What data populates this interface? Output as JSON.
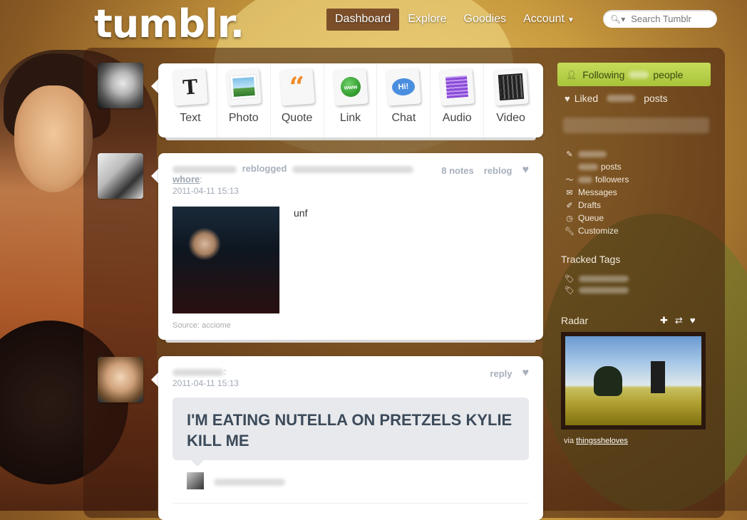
{
  "header": {
    "logo": "tumblr.",
    "nav": [
      {
        "label": "Dashboard",
        "active": true
      },
      {
        "label": "Explore",
        "active": false
      },
      {
        "label": "Goodies",
        "active": false
      },
      {
        "label": "Account",
        "active": false
      }
    ],
    "search_placeholder": "Search Tumblr"
  },
  "composer": {
    "types": [
      {
        "label": "Text",
        "icon": "text-icon"
      },
      {
        "label": "Photo",
        "icon": "photo-icon"
      },
      {
        "label": "Quote",
        "icon": "quote-icon"
      },
      {
        "label": "Link",
        "icon": "link-icon"
      },
      {
        "label": "Chat",
        "icon": "chat-icon"
      },
      {
        "label": "Audio",
        "icon": "audio-icon"
      },
      {
        "label": "Video",
        "icon": "video-icon"
      }
    ],
    "link_icon_text": "www",
    "chat_icon_text": "Hi!"
  },
  "posts": [
    {
      "reblogged_word": "reblogged",
      "who_label": "whore",
      "date": "2011-04-11 15:13",
      "notes": "8 notes",
      "reblog": "reblog",
      "text": "unf",
      "source": "Source: acciome"
    },
    {
      "colon": ":",
      "date": "2011-04-11 15:13",
      "reply": "reply",
      "chat_text": "I'M EATING NUTELLA ON PRETZELS KYLIE KILL ME"
    }
  ],
  "sidebar": {
    "following_pre": "Following",
    "following_post": "people",
    "liked_pre": "Liked",
    "liked_post": "posts",
    "links": [
      {
        "label": "",
        "icon": "edit-icon"
      },
      {
        "label": "posts",
        "icon": "posts-icon"
      },
      {
        "label": "followers",
        "icon": "followers-icon"
      },
      {
        "label": "Messages",
        "icon": "mail-icon"
      },
      {
        "label": "Drafts",
        "icon": "drafts-icon"
      },
      {
        "label": "Queue",
        "icon": "clock-icon"
      },
      {
        "label": "Customize",
        "icon": "wrench-icon"
      }
    ],
    "tracked_tags_title": "Tracked Tags",
    "radar_title": "Radar",
    "radar_via": "via",
    "radar_user": "thingssheloves"
  }
}
